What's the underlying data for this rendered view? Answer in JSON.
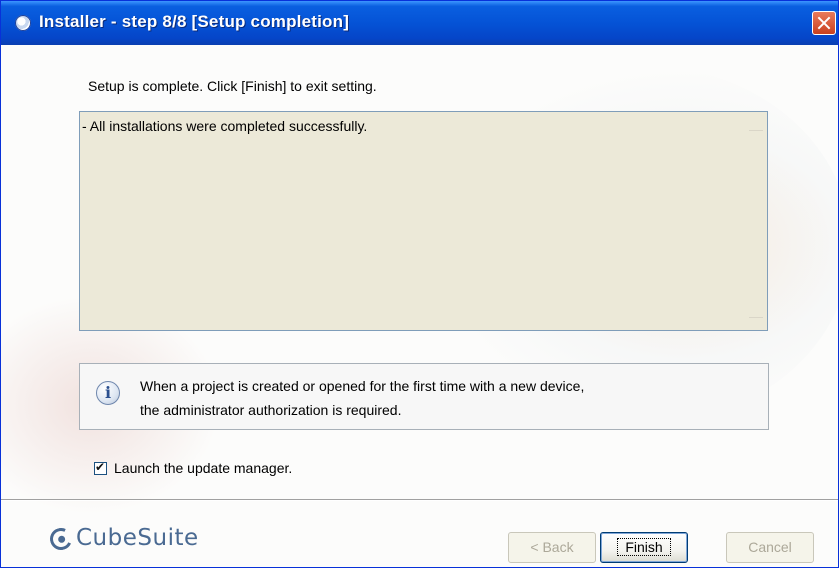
{
  "window": {
    "title": "Installer - step 8/8 [Setup completion]"
  },
  "content": {
    "intro_text": "Setup is complete. Click [Finish] to exit setting.",
    "log_text": "- All installations were completed successfully.",
    "info_line_1": "When a project is created or opened for the first time with a new device,",
    "info_line_2": "the administrator authorization is required.",
    "info_icon_glyph": "i"
  },
  "checkbox": {
    "label": "Launch the update manager.",
    "checked": true
  },
  "footer": {
    "brand": "CubeSuite",
    "back_label": "< Back",
    "finish_label": "Finish",
    "cancel_label": "Cancel"
  },
  "colors": {
    "titlebar": "#0553d6",
    "close_button": "#c9401f",
    "brand": "#4a6a92",
    "log_background": "#ece9d8"
  }
}
